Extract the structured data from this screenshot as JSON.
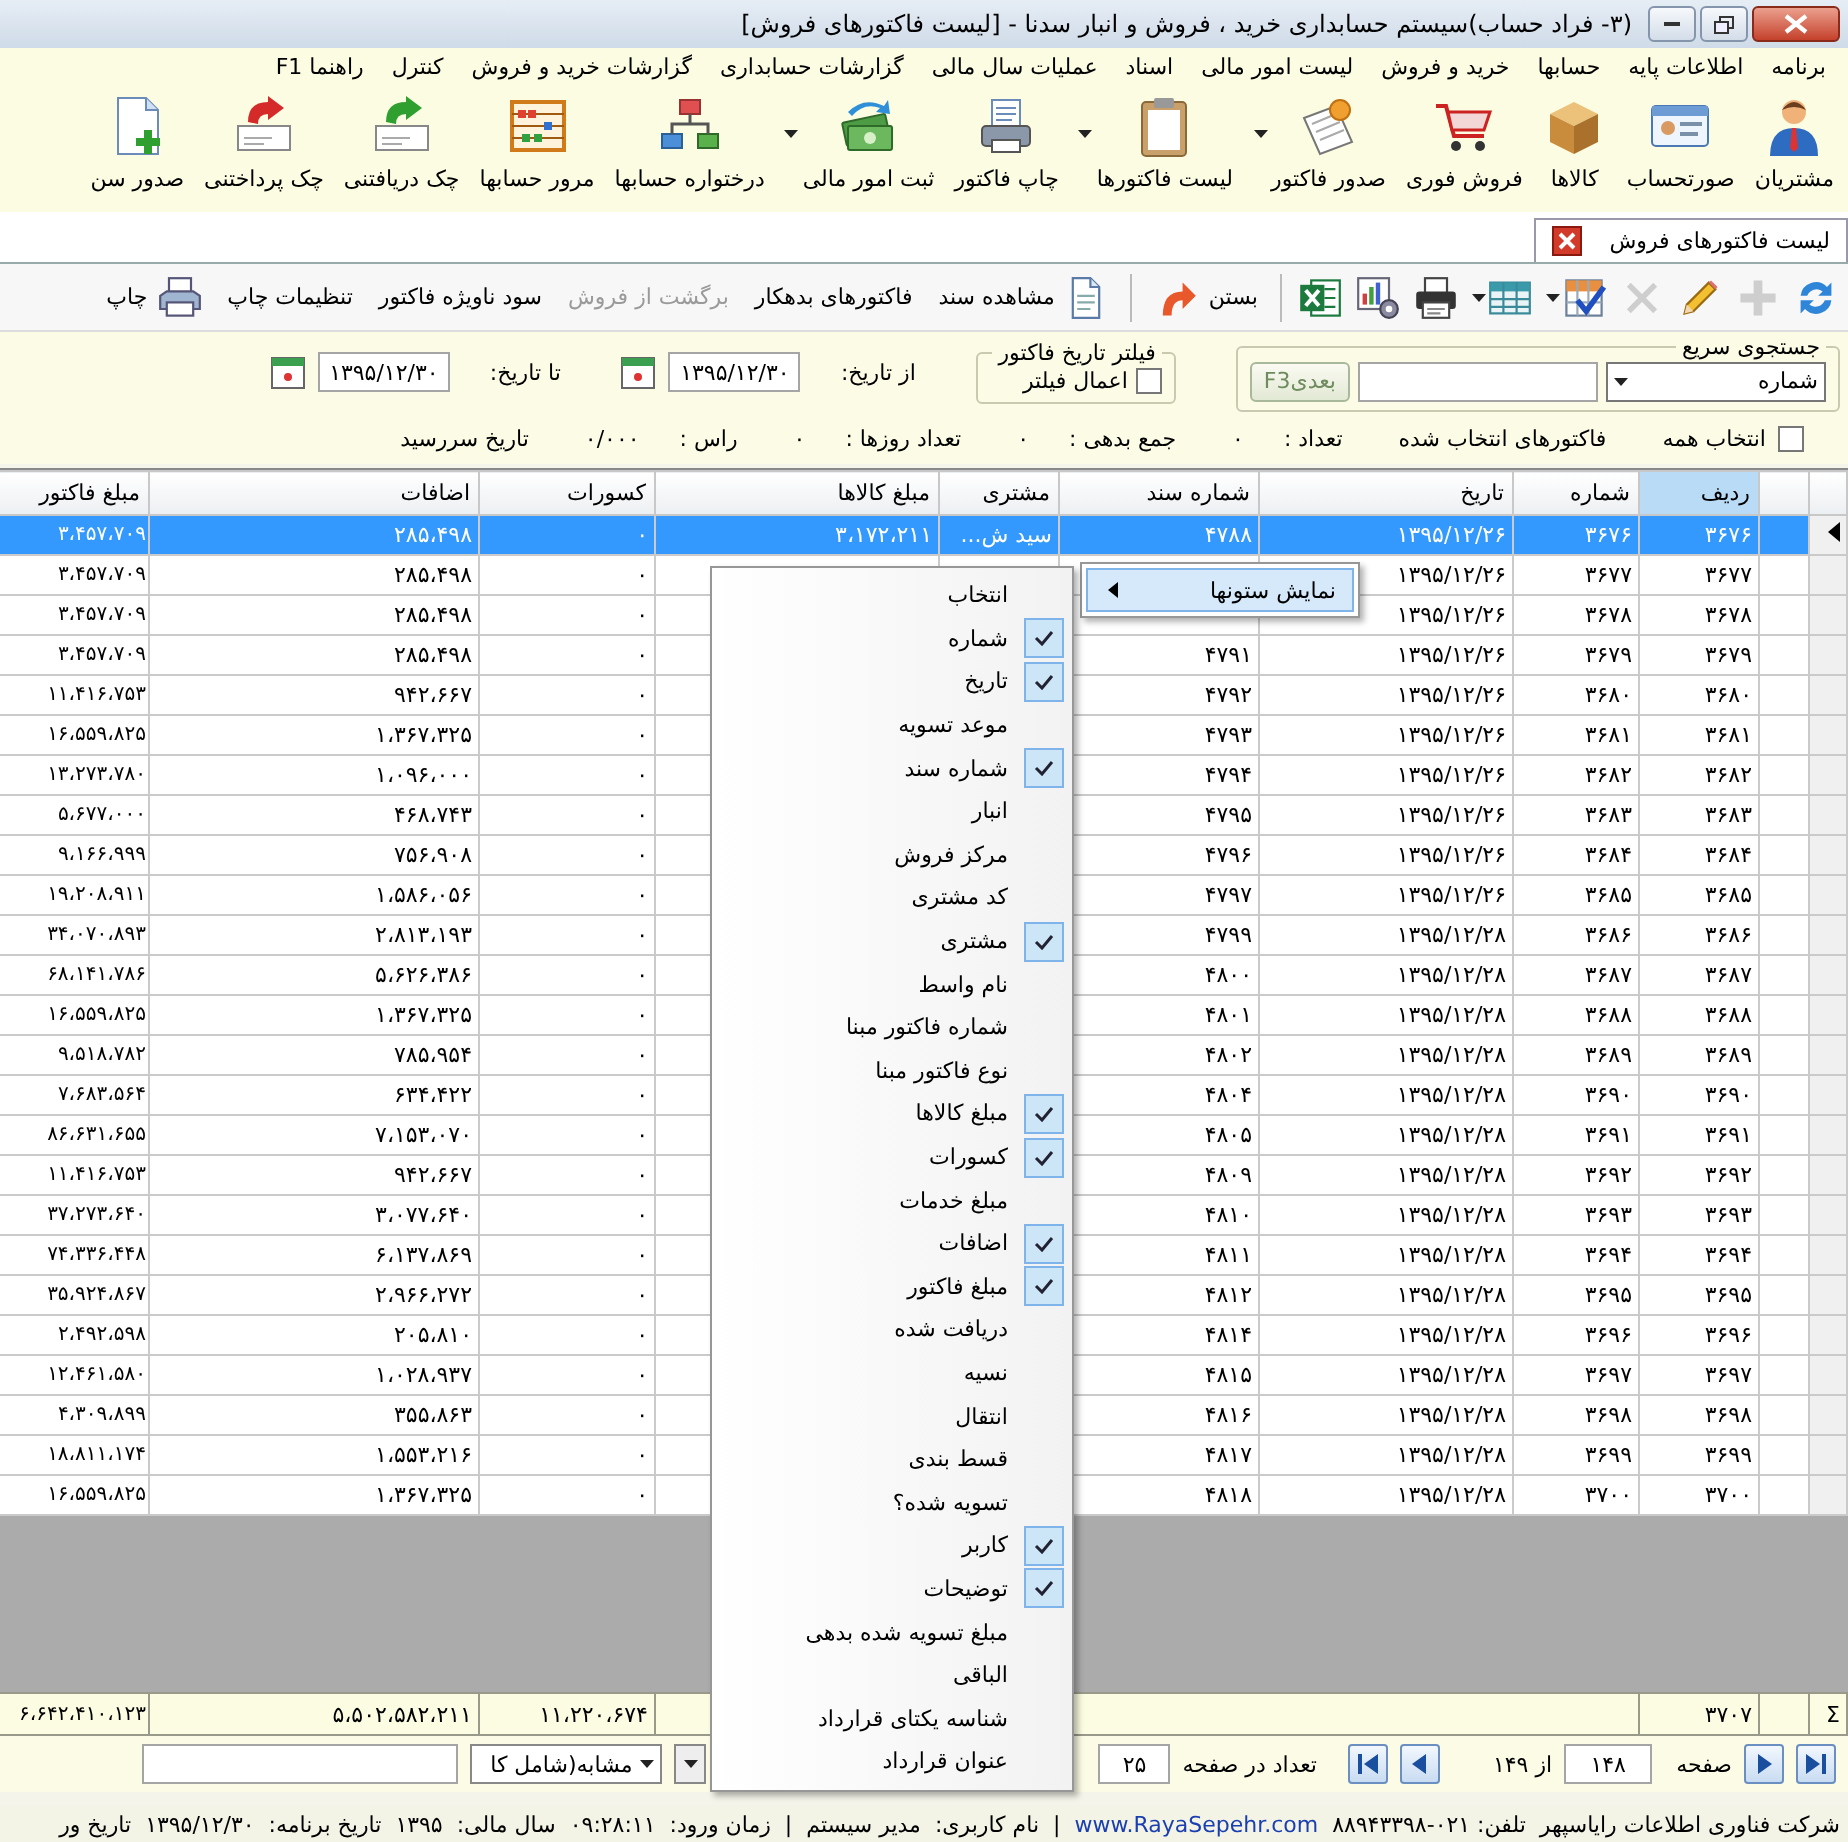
{
  "window": {
    "title": "(۳- فراد حساب)سیستم حسابداری خرید ، فروش و انبار سدنا - [لیست فاکتورهای فروش]"
  },
  "menu_bar": [
    "برنامه",
    "اطلاعات پایه",
    "حسابها",
    "خرید و فروش",
    "لیست امور مالی",
    "اسناد",
    "عملیات سال مالی",
    "گزارشات حسابداری",
    "گزارشات خرید و فروش",
    "کنترل",
    "راهنما F1"
  ],
  "toolbar": [
    {
      "label": "مشتریان",
      "has_menu": false
    },
    {
      "label": "صورتحساب",
      "has_menu": false
    },
    {
      "label": "کالاها",
      "has_menu": false
    },
    {
      "label": "فروش فوری",
      "has_menu": false
    },
    {
      "label": "صدور فاکتور",
      "has_menu": true
    },
    {
      "label": "لیست فاکتورها",
      "has_menu": true
    },
    {
      "label": "چاپ فاکتور",
      "has_menu": false
    },
    {
      "label": "ثبت امور مالی",
      "has_menu": true
    },
    {
      "label": "درختواره حسابها",
      "has_menu": false
    },
    {
      "label": "مرور حسابها",
      "has_menu": false
    },
    {
      "label": "چک دریافتنی",
      "has_menu": false
    },
    {
      "label": "چک پرداختنی",
      "has_menu": false
    },
    {
      "label": "صدور سن",
      "has_menu": false
    }
  ],
  "document_tabs": [
    {
      "label": "لیست فاکتورهای فروش",
      "selected": true
    }
  ],
  "grid_toolbar": [
    {
      "kind": "icon",
      "disabled": false,
      "has_menu": false
    },
    {
      "kind": "icon",
      "disabled": true,
      "has_menu": false
    },
    {
      "kind": "icon",
      "disabled": false,
      "has_menu": false
    },
    {
      "kind": "icon",
      "disabled": true,
      "has_menu": false
    },
    {
      "kind": "icon",
      "disabled": false,
      "has_menu": true
    },
    {
      "kind": "icon",
      "disabled": false,
      "has_menu": true
    },
    {
      "kind": "icon",
      "disabled": false,
      "has_menu": false
    },
    {
      "kind": "icon",
      "disabled": false,
      "has_menu": false
    },
    {
      "kind": "icon",
      "disabled": false,
      "has_menu": false
    },
    {
      "kind": "separator"
    },
    {
      "kind": "icon_text",
      "label": "بستن",
      "disabled": false,
      "icon_after": true
    },
    {
      "kind": "separator"
    },
    {
      "kind": "icon_text",
      "label": "مشاهده سند",
      "disabled": false,
      "icon_after": false
    },
    {
      "kind": "text",
      "label": "فاکتورهای بدهکار",
      "disabled": false
    },
    {
      "kind": "text",
      "label": "برگشت از فروش",
      "disabled": true
    },
    {
      "kind": "text",
      "label": "سود ناویژه فاکتور",
      "disabled": false
    },
    {
      "kind": "text",
      "label": "تنظیمات چاپ",
      "disabled": false
    },
    {
      "kind": "icon_text",
      "label": "چاپ",
      "disabled": false,
      "icon_after": false
    }
  ],
  "quick_search": {
    "title": "جستجوی سریع",
    "field": "شماره",
    "next_button": "بعدیF3"
  },
  "date_filter": {
    "title": "فیلتر تاریخ فاکتور",
    "apply_label": "اعمال فیلتر",
    "checked": false,
    "from_label": "از تاریخ:",
    "from_date": "۱۳۹۵/۱۲/۳۰",
    "to_label": "تا تاریخ:",
    "to_date": "۱۳۹۵/۱۲/۳۰"
  },
  "summary": {
    "select_all": {
      "label": "انتخاب همه",
      "checked": false
    },
    "items": [
      {
        "label": "فاکتورهای انتخاب شده"
      },
      {
        "label": "تعداد :",
        "value": "۰"
      },
      {
        "label": "جمع بدهی :",
        "value": "۰"
      },
      {
        "label": "تعداد روزها :",
        "value": "۰"
      },
      {
        "label": "راس :",
        "value": "۰/۰۰۰"
      },
      {
        "label": "تاریخ سررسید"
      }
    ]
  },
  "table": {
    "columns": [
      {
        "label": "ردیف",
        "sorted": true
      },
      {
        "label": "شماره",
        "sorted": false
      },
      {
        "label": "تاریخ",
        "sorted": false
      },
      {
        "label": "شماره سند",
        "sorted": false
      },
      {
        "label": "مشتری",
        "sorted": false
      },
      {
        "label": "مبلغ کالاها",
        "sorted": false
      },
      {
        "label": "کسورات",
        "sorted": false
      },
      {
        "label": "اضافات",
        "sorted": false
      },
      {
        "label": "مبلغ فاکتور",
        "sorted": false
      }
    ],
    "rows": [
      {
        "row_no": "۳۶۷۶",
        "number": "۳۶۷۶",
        "date": "۱۳۹۵/۱۲/۲۶",
        "doc_no": "۴۷۸۸",
        "customer": "سید ش...",
        "goods_amount": "۳،۱۷۲،۲۱۱",
        "deductions": "۰",
        "additions": "۲۸۵،۴۹۸",
        "invoice_amount": "۳،۴۵۷،۷۰۹",
        "selected": true
      },
      {
        "row_no": "۳۶۷۷",
        "number": "۳۶۷۷",
        "date": "۱۳۹۵/۱۲/۲۶",
        "deductions": "۰",
        "additions": "۲۸۵،۴۹۸",
        "invoice_amount": "۳،۴۵۷،۷۰۹",
        "selected": false
      },
      {
        "row_no": "۳۶۷۸",
        "number": "۳۶۷۸",
        "date": "۱۳۹۵/۱۲/۲۶",
        "deductions": "۰",
        "additions": "۲۸۵،۴۹۸",
        "invoice_amount": "۳،۴۵۷،۷۰۹",
        "selected": false
      },
      {
        "row_no": "۳۶۷۹",
        "number": "۳۶۷۹",
        "date": "۱۳۹۵/۱۲/۲۶",
        "doc_no": "۴۷۹۱",
        "deductions": "۰",
        "additions": "۲۸۵،۴۹۸",
        "invoice_amount": "۳،۴۵۷،۷۰۹",
        "selected": false
      },
      {
        "row_no": "۳۶۸۰",
        "number": "۳۶۸۰",
        "date": "۱۳۹۵/۱۲/۲۶",
        "doc_no": "۴۷۹۲",
        "deductions": "۰",
        "additions": "۹۴۲،۶۶۷",
        "invoice_amount": "۱۱،۴۱۶،۷۵۳",
        "selected": false
      },
      {
        "row_no": "۳۶۸۱",
        "number": "۳۶۸۱",
        "date": "۱۳۹۵/۱۲/۲۶",
        "doc_no": "۴۷۹۳",
        "deductions": "۰",
        "additions": "۱،۳۶۷،۳۲۵",
        "invoice_amount": "۱۶،۵۵۹،۸۲۵",
        "selected": false
      },
      {
        "row_no": "۳۶۸۲",
        "number": "۳۶۸۲",
        "date": "۱۳۹۵/۱۲/۲۶",
        "doc_no": "۴۷۹۴",
        "deductions": "۰",
        "additions": "۱،۰۹۶،۰۰۰",
        "invoice_amount": "۱۳،۲۷۳،۷۸۰",
        "selected": false
      },
      {
        "row_no": "۳۶۸۳",
        "number": "۳۶۸۳",
        "date": "۱۳۹۵/۱۲/۲۶",
        "doc_no": "۴۷۹۵",
        "deductions": "۰",
        "additions": "۴۶۸،۷۴۳",
        "invoice_amount": "۵،۶۷۷،۰۰۰",
        "selected": false
      },
      {
        "row_no": "۳۶۸۴",
        "number": "۳۶۸۴",
        "date": "۱۳۹۵/۱۲/۲۶",
        "doc_no": "۴۷۹۶",
        "deductions": "۰",
        "additions": "۷۵۶،۹۰۸",
        "invoice_amount": "۹،۱۶۶،۹۹۹",
        "selected": false
      },
      {
        "row_no": "۳۶۸۵",
        "number": "۳۶۸۵",
        "date": "۱۳۹۵/۱۲/۲۶",
        "doc_no": "۴۷۹۷",
        "deductions": "۰",
        "additions": "۱،۵۸۶،۰۵۶",
        "invoice_amount": "۱۹،۲۰۸،۹۱۱",
        "selected": false
      },
      {
        "row_no": "۳۶۸۶",
        "number": "۳۶۸۶",
        "date": "۱۳۹۵/۱۲/۲۸",
        "doc_no": "۴۷۹۹",
        "deductions": "۰",
        "additions": "۲،۸۱۳،۱۹۳",
        "invoice_amount": "۳۴،۰۷۰،۸۹۳",
        "selected": false
      },
      {
        "row_no": "۳۶۸۷",
        "number": "۳۶۸۷",
        "date": "۱۳۹۵/۱۲/۲۸",
        "doc_no": "۴۸۰۰",
        "deductions": "۰",
        "additions": "۵،۶۲۶،۳۸۶",
        "invoice_amount": "۶۸،۱۴۱،۷۸۶",
        "selected": false
      },
      {
        "row_no": "۳۶۸۸",
        "number": "۳۶۸۸",
        "date": "۱۳۹۵/۱۲/۲۸",
        "doc_no": "۴۸۰۱",
        "deductions": "۰",
        "additions": "۱،۳۶۷،۳۲۵",
        "invoice_amount": "۱۶،۵۵۹،۸۲۵",
        "selected": false
      },
      {
        "row_no": "۳۶۸۹",
        "number": "۳۶۸۹",
        "date": "۱۳۹۵/۱۲/۲۸",
        "doc_no": "۴۸۰۲",
        "deductions": "۰",
        "additions": "۷۸۵،۹۵۴",
        "invoice_amount": "۹،۵۱۸،۷۸۲",
        "selected": false
      },
      {
        "row_no": "۳۶۹۰",
        "number": "۳۶۹۰",
        "date": "۱۳۹۵/۱۲/۲۸",
        "doc_no": "۴۸۰۴",
        "deductions": "۰",
        "additions": "۶۳۴،۴۲۲",
        "invoice_amount": "۷،۶۸۳،۵۶۴",
        "selected": false
      },
      {
        "row_no": "۳۶۹۱",
        "number": "۳۶۹۱",
        "date": "۱۳۹۵/۱۲/۲۸",
        "doc_no": "۴۸۰۵",
        "deductions": "۰",
        "additions": "۷،۱۵۳،۰۷۰",
        "invoice_amount": "۸۶،۶۳۱،۶۵۵",
        "selected": false
      },
      {
        "row_no": "۳۶۹۲",
        "number": "۳۶۹۲",
        "date": "۱۳۹۵/۱۲/۲۸",
        "doc_no": "۴۸۰۹",
        "deductions": "۰",
        "additions": "۹۴۲،۶۶۷",
        "invoice_amount": "۱۱،۴۱۶،۷۵۳",
        "selected": false
      },
      {
        "row_no": "۳۶۹۳",
        "number": "۳۶۹۳",
        "date": "۱۳۹۵/۱۲/۲۸",
        "doc_no": "۴۸۱۰",
        "deductions": "۰",
        "additions": "۳،۰۷۷،۶۴۰",
        "invoice_amount": "۳۷،۲۷۳،۶۴۰",
        "selected": false
      },
      {
        "row_no": "۳۶۹۴",
        "number": "۳۶۹۴",
        "date": "۱۳۹۵/۱۲/۲۸",
        "doc_no": "۴۸۱۱",
        "deductions": "۰",
        "additions": "۶،۱۳۷،۸۶۹",
        "invoice_amount": "۷۴،۳۳۶،۴۴۸",
        "selected": false
      },
      {
        "row_no": "۳۶۹۵",
        "number": "۳۶۹۵",
        "date": "۱۳۹۵/۱۲/۲۸",
        "doc_no": "۴۸۱۲",
        "deductions": "۰",
        "additions": "۲،۹۶۶،۲۷۲",
        "invoice_amount": "۳۵،۹۲۴،۸۶۷",
        "selected": false
      },
      {
        "row_no": "۳۶۹۶",
        "number": "۳۶۹۶",
        "date": "۱۳۹۵/۱۲/۲۸",
        "doc_no": "۴۸۱۴",
        "deductions": "۰",
        "additions": "۲۰۵،۸۱۰",
        "invoice_amount": "۲،۴۹۲،۵۹۸",
        "selected": false
      },
      {
        "row_no": "۳۶۹۷",
        "number": "۳۶۹۷",
        "date": "۱۳۹۵/۱۲/۲۸",
        "doc_no": "۴۸۱۵",
        "deductions": "۰",
        "additions": "۱،۰۲۸،۹۳۷",
        "invoice_amount": "۱۲،۴۶۱،۵۸۰",
        "selected": false
      },
      {
        "row_no": "۳۶۹۸",
        "number": "۳۶۹۸",
        "date": "۱۳۹۵/۱۲/۲۸",
        "doc_no": "۴۸۱۶",
        "deductions": "۰",
        "additions": "۳۵۵،۸۶۳",
        "invoice_amount": "۴،۳۰۹،۸۹۹",
        "selected": false
      },
      {
        "row_no": "۳۶۹۹",
        "number": "۳۶۹۹",
        "date": "۱۳۹۵/۱۲/۲۸",
        "doc_no": "۴۸۱۷",
        "deductions": "۰",
        "additions": "۱،۵۵۳،۲۱۶",
        "invoice_amount": "۱۸،۸۱۱،۱۷۴",
        "selected": false
      },
      {
        "row_no": "۳۷۰۰",
        "number": "۳۷۰۰",
        "date": "۱۳۹۵/۱۲/۲۸",
        "doc_no": "۴۸۱۸",
        "deductions": "۰",
        "additions": "۱،۳۶۷،۳۲۵",
        "invoice_amount": "۱۶،۵۵۹،۸۲۵",
        "selected": false
      }
    ],
    "totals": {
      "symbol": "Σ",
      "row_count": "۳۷۰۷",
      "deductions": "۱۱،۲۲۰،۶۷۴",
      "additions": "۵،۵۰۲،۵۸۲،۲۱۱",
      "invoice_amount": "۶،۶۴۲،۴۱۰،۱۲۳"
    }
  },
  "pager": {
    "page_label": "صفحه",
    "page": "۱۴۸",
    "of_label": "از ۱۴۹",
    "page_size_label": "تعداد در صفحه",
    "page_size": "۲۵",
    "match_mode": "مشابه(شامل کا"
  },
  "status_bar": [
    {
      "kind": "text",
      "text": "شرکت فناوری اطلاعات رایاسپهر"
    },
    {
      "kind": "text",
      "text": "تلفن: ۰۲۱-۸۸۹۴۳۳۹۸"
    },
    {
      "kind": "link",
      "text": "www.RayaSepehr.com"
    },
    {
      "kind": "text",
      "text": "|"
    },
    {
      "kind": "text",
      "text": "نام کاربری:"
    },
    {
      "kind": "text",
      "text": "مدیر سیستم"
    },
    {
      "kind": "text",
      "text": "|"
    },
    {
      "kind": "text",
      "text": "زمان ورود:"
    },
    {
      "kind": "text",
      "text": "۰۹:۲۸:۱۱"
    },
    {
      "kind": "text",
      "text": "سال مالی:"
    },
    {
      "kind": "text",
      "text": "۱۳۹۵"
    },
    {
      "kind": "text",
      "text": "تاریخ برنامه:"
    },
    {
      "kind": "text",
      "text": "۱۳۹۵/۱۲/۳۰"
    },
    {
      "kind": "text",
      "text": "تاریخ ور"
    }
  ],
  "column_menu": {
    "parent_item": "نمایش ستونها",
    "items": [
      {
        "label": "انتخاب",
        "checked": false
      },
      {
        "label": "شماره",
        "checked": true
      },
      {
        "label": "تاریخ",
        "checked": true
      },
      {
        "label": "موعد تسویه",
        "checked": false
      },
      {
        "label": "شماره سند",
        "checked": true
      },
      {
        "label": "انبار",
        "checked": false
      },
      {
        "label": "مرکز فروش",
        "checked": false
      },
      {
        "label": "کد مشتری",
        "checked": false
      },
      {
        "label": "مشتری",
        "checked": true
      },
      {
        "label": "نام واسط",
        "checked": false
      },
      {
        "label": "شماره فاکتور مبنا",
        "checked": false
      },
      {
        "label": "نوع فاکتور مبنا",
        "checked": false
      },
      {
        "label": "مبلغ کالاها",
        "checked": true
      },
      {
        "label": "کسورات",
        "checked": true
      },
      {
        "label": "مبلغ خدمات",
        "checked": false
      },
      {
        "label": "اضافات",
        "checked": true
      },
      {
        "label": "مبلغ فاکتور",
        "checked": true
      },
      {
        "label": "دریافت شده",
        "checked": false
      },
      {
        "label": "نسیه",
        "checked": false
      },
      {
        "label": "انتقال",
        "checked": false
      },
      {
        "label": "قسط بندی",
        "checked": false
      },
      {
        "label": "تسویه شده؟",
        "checked": false
      },
      {
        "label": "کاربر",
        "checked": true
      },
      {
        "label": "توضیحات",
        "checked": true
      },
      {
        "label": "مبلغ تسویه شده بدهی",
        "checked": false
      },
      {
        "label": "الباقی",
        "checked": false
      },
      {
        "label": "شناسه یکتای قرارداد",
        "checked": false
      },
      {
        "label": "عنوان قرارداد",
        "checked": false
      }
    ]
  }
}
